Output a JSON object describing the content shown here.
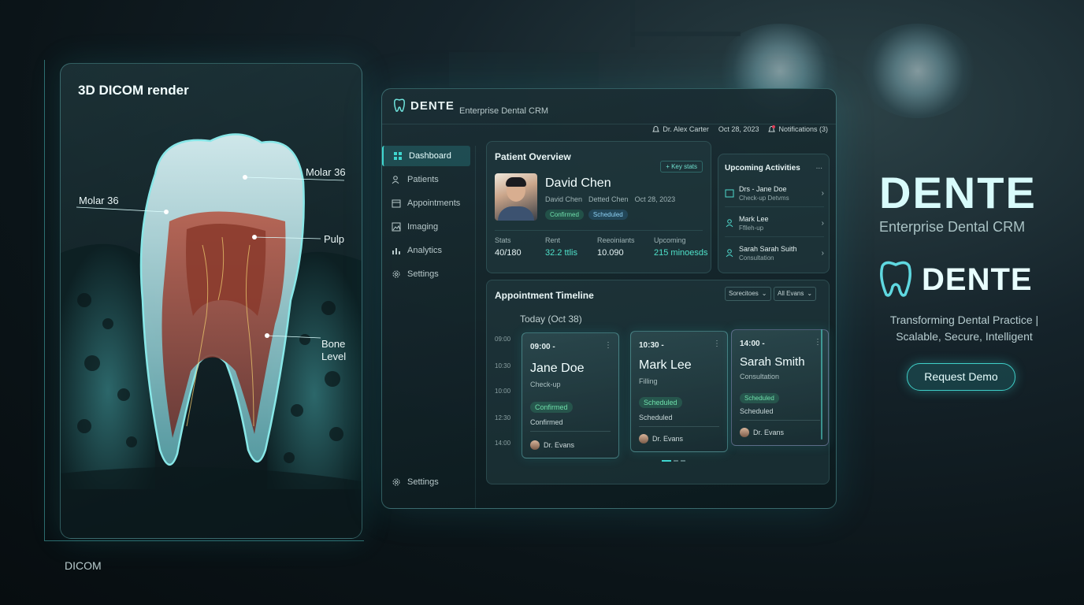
{
  "dicom": {
    "title": "3D DICOM render",
    "labels": {
      "molar_right": "Molar 36",
      "molar_left": "Molar 36",
      "pulp": "Pulp",
      "bone_1": "Bone",
      "bone_2": "Level"
    },
    "footer": "DICOM"
  },
  "app": {
    "logo": "DENTE",
    "subtitle": "Enterprise Dental CRM",
    "user": "Dr. Alex Carter",
    "date": "Oct 28, 2023",
    "notifications": "Notifications (3)"
  },
  "sidebar": {
    "items": [
      {
        "label": "Dashboard",
        "icon": "grid-icon"
      },
      {
        "label": "Patients",
        "icon": "users-icon"
      },
      {
        "label": "Appointments",
        "icon": "calendar-icon"
      },
      {
        "label": "Imaging",
        "icon": "image-icon"
      },
      {
        "label": "Analytics",
        "icon": "bar-chart-icon"
      },
      {
        "label": "Settings",
        "icon": "gear-icon"
      }
    ],
    "bottom": "Settings"
  },
  "overview": {
    "title": "Patient Overview",
    "key_stats": "+ Key stats",
    "name": "David Chen",
    "sub1": "David Chen",
    "sub2": "Detted Chen",
    "sub3": "Oct 28, 2023",
    "badge1": "Confirmed",
    "badge2": "Scheduled",
    "stats": [
      {
        "label": "Stats",
        "value": "40/180"
      },
      {
        "label": "Rent",
        "value": "32.2 ttlis"
      },
      {
        "label": "Reeoiniants",
        "value": "10.090"
      },
      {
        "label": "Upcoming",
        "value": "215 minoesds"
      }
    ]
  },
  "activities": {
    "title": "Upcoming Activities",
    "more": "...",
    "items": [
      {
        "name": "Drs - Jane Doe",
        "detail": "Check-up Detvms"
      },
      {
        "name": "Mark Lee",
        "detail": "Fflleh-up"
      },
      {
        "name": "Sarah Sarah Suith",
        "detail": "Consultation"
      }
    ]
  },
  "timeline": {
    "title": "Appointment Timeline",
    "filter1": "Sorecitoes",
    "filter2": "All Evans",
    "today": "Today (Oct 38)",
    "times": [
      "09:00",
      "10:30",
      "10:00",
      "12:30",
      "14:00"
    ],
    "appointments": [
      {
        "time": "09:00 -",
        "name": "Jane Doe",
        "type": "Check-up",
        "badge": "Confirmed",
        "status": "Confirmed",
        "doctor": "Dr. Evans"
      },
      {
        "time": "10:30 -",
        "name": "Mark Lee",
        "type": "Filling",
        "badge": "Scheduled",
        "status": "Scheduled",
        "doctor": "Dr. Evans"
      },
      {
        "time": "14:00 -",
        "name": "Sarah Smith",
        "type": "Consultation",
        "badge": "Scheduled",
        "status": "Scheduled",
        "doctor": "Dr. Evans"
      }
    ]
  },
  "brand": {
    "headline": "DENTE",
    "headline_sub": "Enterprise Dental CRM",
    "logo_text": "DENTE",
    "tagline_1": "Transforming Dental Practice |",
    "tagline_2": "Scalable, Secure, Intelligent",
    "cta": "Request Demo"
  },
  "colors": {
    "accent": "#3fd6cf",
    "confirmed": "#6fe0ab",
    "scheduled": "#8ed2f5"
  }
}
